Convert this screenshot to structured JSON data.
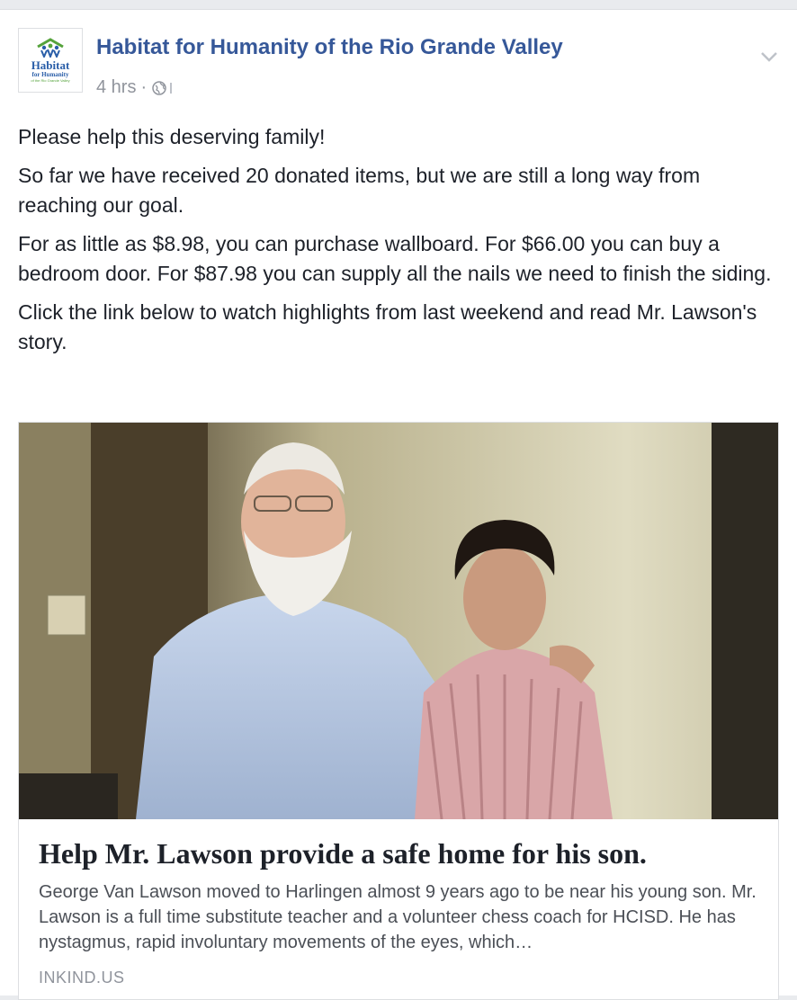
{
  "post": {
    "page_name": "Habitat for Humanity of the Rio Grande Valley",
    "timestamp": "4 hrs",
    "separator": "·",
    "privacy_icon": "globe-icon",
    "menu_icon": "chevron-down-icon",
    "avatar": {
      "logo_word": "Habitat",
      "logo_sub": "for Humanity",
      "logo_tiny": "of the Rio Grande Valley",
      "colors": {
        "blue": "#2a5ea8",
        "green": "#55a33b"
      }
    },
    "paragraphs": [
      "Please help this deserving family!",
      "So far we have received 20 donated items, but we are still a long way from reaching our goal.",
      "For as little as $8.98, you can purchase wallboard. For $66.00 you can buy a bedroom door. For $87.98 you can supply all the nails we need to finish the siding.",
      "Click the link below to watch highlights from last weekend and read Mr. Lawson's story."
    ]
  },
  "link_preview": {
    "title": "Help Mr. Lawson provide a safe home for his son.",
    "description": "George Van Lawson moved to Harlingen almost 9 years ago to be near his young son. Mr. Lawson is a full time substitute teacher and a volunteer chess coach for HCISD. He has nystagmus, rapid involuntary movements of the eyes, which…",
    "domain": "INKIND.US"
  },
  "colors": {
    "link_blue": "#365899",
    "meta_gray": "#90949c",
    "text": "#1d2129",
    "desc": "#4b4f56"
  }
}
